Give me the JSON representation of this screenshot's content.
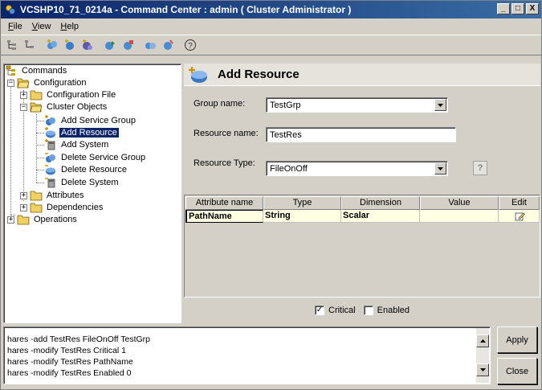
{
  "window": {
    "title": "VCSHP10_71_0214a - Command Center : admin ( Cluster Administrator )",
    "controls": [
      "_",
      "□",
      "X"
    ]
  },
  "menubar": {
    "items": [
      {
        "label": "File",
        "accel": "F"
      },
      {
        "label": "View",
        "accel": "V"
      },
      {
        "label": "Help",
        "accel": "H"
      }
    ]
  },
  "toolbar": {
    "buttons": [
      {
        "icon": "tree-view-icon"
      },
      {
        "icon": "commands-view-icon"
      },
      {
        "icon": "add-service-group-icon"
      },
      {
        "icon": "add-resource-icon"
      },
      {
        "icon": "add-system-icon"
      },
      {
        "icon": "online-icon"
      },
      {
        "icon": "offline-icon"
      },
      {
        "icon": "switch-icon"
      },
      {
        "icon": "clear-fault-icon"
      },
      {
        "icon": "help-icon"
      }
    ]
  },
  "tree": {
    "root": "Commands",
    "configuration": "Configuration",
    "configuration_file": "Configuration File",
    "cluster_objects": "Cluster Objects",
    "add_service_group": "Add Service Group",
    "add_resource": "Add Resource",
    "add_system": "Add System",
    "delete_service_group": "Delete Service Group",
    "delete_resource": "Delete Resource",
    "delete_system": "Delete System",
    "attributes": "Attributes",
    "dependencies": "Dependencies",
    "operations": "Operations",
    "selected": "Add Resource"
  },
  "panel": {
    "title": "Add Resource",
    "group_label": "Group name:",
    "group_value": "TestGrp",
    "resource_label": "Resource name:",
    "resource_value": "TestRes",
    "type_label": "Resource Type:",
    "type_value": "FileOnOff"
  },
  "grid": {
    "columns": [
      "Attribute name",
      "Type",
      "Dimension",
      "Value",
      "Edit"
    ],
    "rows": [
      {
        "attribute": "PathName",
        "type": "String",
        "dimension": "Scalar",
        "value": "",
        "edit_icon": "edit-pencil-icon"
      }
    ]
  },
  "options": {
    "critical_label": "Critical",
    "critical_checked": true,
    "enabled_label": "Enabled",
    "enabled_checked": false
  },
  "commands": {
    "lines": [
      "hares -add TestRes  FileOnOff  TestGrp",
      "hares -modify TestRes Critical 1",
      "hares -modify TestRes PathName",
      "hares -modify TestRes Enabled 0"
    ]
  },
  "buttons": {
    "apply": "Apply",
    "close": "Close"
  }
}
